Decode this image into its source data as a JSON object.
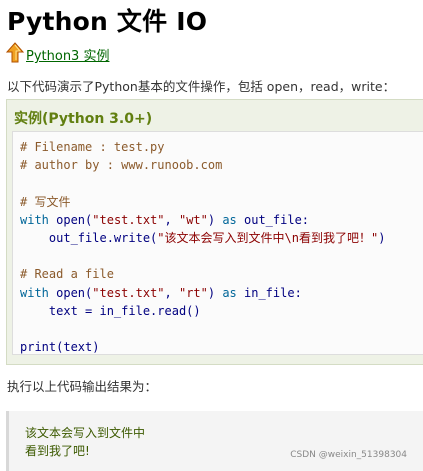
{
  "page": {
    "title": "Python 文件 IO",
    "crumb_link": "Python3 实例",
    "intro": "以下代码演示了Python基本的文件操作，包括 open，read，write：",
    "example_title": "实例(Python 3.0+)",
    "output_label": "执行以上代码输出结果为：",
    "watermark": "CSDN @weixin_51398304"
  },
  "code": {
    "line1": "# Filename : test.py",
    "line2": "# author by : www.runoob.com",
    "line3": "# 写文件",
    "line4_kw": "with",
    "line4_a": " open(",
    "line4_s1": "\"test.txt\"",
    "line4_b": ", ",
    "line4_s2": "\"wt\"",
    "line4_c": ") ",
    "line4_kw2": "as",
    "line4_d": " out_file:",
    "line5_a": "    out_file.write(",
    "line5_s": "\"该文本会写入到文件中\\n看到我了吧！\"",
    "line5_b": ")",
    "line6": "# Read a file",
    "line7_kw": "with",
    "line7_a": " open(",
    "line7_s1": "\"test.txt\"",
    "line7_b": ", ",
    "line7_s2": "\"rt\"",
    "line7_c": ") ",
    "line7_kw2": "as",
    "line7_d": " in_file:",
    "line8": "    text = in_file.read()",
    "line9": "print(text)"
  },
  "output": {
    "line1": "该文本会写入到文件中",
    "line2": "看到我了吧!"
  },
  "icons": {
    "crumb_icon": "up-arrow-icon"
  }
}
